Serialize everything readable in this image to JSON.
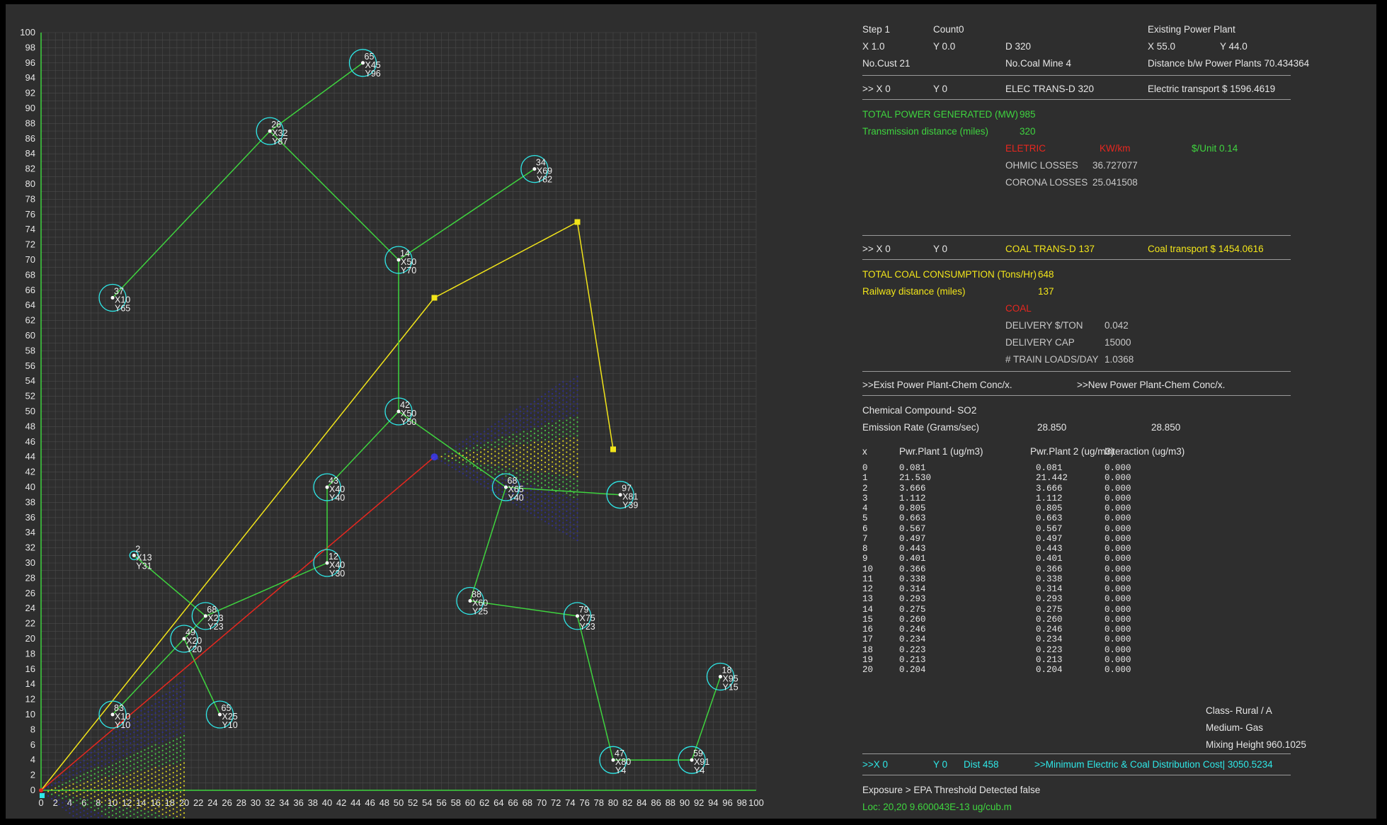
{
  "colors": {
    "background": "#2e2e2e",
    "grid": "#4a4a4a",
    "axis": "#3fd43f",
    "customer_ring": "#2ee8e8",
    "customer_link": "#3fd43f",
    "coal_route": "#f2e51a",
    "electric_route": "#e8271f",
    "plume_near": "#e8e020",
    "plume_mid": "#49d449",
    "plume_outer": "#2d2d9a"
  },
  "info": {
    "step": "Step 1",
    "count": "Count0",
    "existing_plant_title": "Existing Power Plant",
    "x": "X 1.0",
    "y": "Y 0.0",
    "d": "D 320",
    "existing_x": "X 55.0",
    "existing_y": "Y 44.0",
    "no_cust": "No.Cust 21",
    "no_coal_mine": "No.Coal Mine 4",
    "distance_plants": "Distance b/w Power Plants 70.434364"
  },
  "elec": {
    "x": ">> X 0",
    "y": "Y 0",
    "trans_d": "ELEC TRANS-D 320",
    "transport": "Electric transport $ 1596.4619",
    "total_power_label": "TOTAL POWER GENERATED (MW)",
    "total_power_value": "985",
    "trans_dist_label": "Transmission distance (miles)",
    "trans_dist_value": "320",
    "eletric": "ELETRIC",
    "kwkm": "KW/km",
    "unit": "$/Unit 0.14",
    "ohmic_label": "OHMIC LOSSES",
    "ohmic_value": "36.727077",
    "corona_label": "CORONA LOSSES",
    "corona_value": "25.041508"
  },
  "coal": {
    "x": ">> X 0",
    "y": "Y 0",
    "trans_d": "COAL TRANS-D 137",
    "transport": "Coal transport $ 1454.0616",
    "total_label": "TOTAL COAL CONSUMPTION (Tons/Hr)",
    "total_value": "648",
    "rail_label": "Railway distance (miles)",
    "rail_value": "137",
    "coal": "COAL",
    "delivery_ton_label": "DELIVERY $/TON",
    "delivery_ton_value": "0.042",
    "delivery_cap_label": "DELIVERY CAP",
    "delivery_cap_value": "15000",
    "train_loads_label": "# TRAIN LOADS/DAY",
    "train_loads_value": "1.0368"
  },
  "chem": {
    "exist_button": ">>Exist Power Plant-Chem Conc/x.",
    "new_button": ">>New Power Plant-Chem Conc/x.",
    "compound": "Chemical Compound- SO2",
    "emission_label": "Emission Rate (Grams/sec)",
    "emission_1": "28.850",
    "emission_2": "28.850",
    "headers": [
      "x",
      "Pwr.Plant 1 (ug/m3)",
      "Pwr.Plant 2 (ug/m3)",
      "Interaction (ug/m3)"
    ],
    "rows": [
      [
        "0",
        "0.081",
        "0.081",
        "0.000"
      ],
      [
        "1",
        "21.530",
        "21.442",
        "0.000"
      ],
      [
        "2",
        "3.666",
        "3.666",
        "0.000"
      ],
      [
        "3",
        "1.112",
        "1.112",
        "0.000"
      ],
      [
        "4",
        "0.805",
        "0.805",
        "0.000"
      ],
      [
        "5",
        "0.663",
        "0.663",
        "0.000"
      ],
      [
        "6",
        "0.567",
        "0.567",
        "0.000"
      ],
      [
        "7",
        "0.497",
        "0.497",
        "0.000"
      ],
      [
        "8",
        "0.443",
        "0.443",
        "0.000"
      ],
      [
        "9",
        "0.401",
        "0.401",
        "0.000"
      ],
      [
        "10",
        "0.366",
        "0.366",
        "0.000"
      ],
      [
        "11",
        "0.338",
        "0.338",
        "0.000"
      ],
      [
        "12",
        "0.314",
        "0.314",
        "0.000"
      ],
      [
        "13",
        "0.293",
        "0.293",
        "0.000"
      ],
      [
        "14",
        "0.275",
        "0.275",
        "0.000"
      ],
      [
        "15",
        "0.260",
        "0.260",
        "0.000"
      ],
      [
        "16",
        "0.246",
        "0.246",
        "0.000"
      ],
      [
        "17",
        "0.234",
        "0.234",
        "0.000"
      ],
      [
        "18",
        "0.223",
        "0.223",
        "0.000"
      ],
      [
        "19",
        "0.213",
        "0.213",
        "0.000"
      ],
      [
        "20",
        "0.204",
        "0.204",
        "0.000"
      ]
    ],
    "class": "Class-  Rural / A",
    "medium": "Medium-  Gas",
    "mixing_height": "Mixing Height  960.1025"
  },
  "footer": {
    "x": ">>X 0",
    "y": "Y 0",
    "dist": "Dist 458",
    "min_cost": ">>Minimum Electric & Coal Distribution Cost|  3050.5234",
    "exposure": "Exposure > EPA Threshold Detected  false",
    "loc": "Loc: 20,20  9.600043E-13 ug/cub.m"
  },
  "map": {
    "axis_max": 100,
    "x_ticks": [
      0,
      2,
      4,
      6,
      8,
      10,
      12,
      14,
      16,
      18,
      20,
      22,
      24,
      26,
      28,
      30,
      32,
      34,
      36,
      38,
      40,
      42,
      44,
      46,
      48,
      50,
      52,
      54,
      56,
      58,
      60,
      62,
      64,
      66,
      68,
      70,
      72,
      74,
      76,
      78,
      80,
      82,
      84,
      86,
      88,
      90,
      92,
      94,
      96,
      98,
      100
    ],
    "y_ticks": [
      0,
      2,
      4,
      6,
      8,
      10,
      12,
      14,
      16,
      18,
      20,
      22,
      24,
      26,
      28,
      30,
      32,
      34,
      36,
      38,
      40,
      42,
      44,
      46,
      48,
      50,
      52,
      54,
      56,
      58,
      60,
      62,
      64,
      66,
      68,
      70,
      72,
      74,
      76,
      78,
      80,
      82,
      84,
      86,
      88,
      90,
      92,
      94,
      96,
      98,
      100
    ],
    "customers": [
      {
        "id": "65",
        "x": 45,
        "y": 96,
        "xl": "X45",
        "yl": "Y96"
      },
      {
        "id": "26",
        "x": 32,
        "y": 87,
        "xl": "X32",
        "yl": "Y87"
      },
      {
        "id": "34",
        "x": 69,
        "y": 82,
        "xl": "X69",
        "yl": "Y82"
      },
      {
        "id": "37",
        "x": 10,
        "y": 65,
        "xl": "X10",
        "yl": "Y65"
      },
      {
        "id": "14",
        "x": 50,
        "y": 70,
        "xl": "X50",
        "yl": "Y70"
      },
      {
        "id": "42",
        "x": 50,
        "y": 50,
        "xl": "X50",
        "yl": "Y50"
      },
      {
        "id": "68",
        "x": 65,
        "y": 40,
        "xl": "X65",
        "yl": "Y40"
      },
      {
        "id": "97",
        "x": 81,
        "y": 39,
        "xl": "X81",
        "yl": "Y39"
      },
      {
        "id": "43",
        "x": 40,
        "y": 40,
        "xl": "X40",
        "yl": "Y40"
      },
      {
        "id": "12",
        "x": 40,
        "y": 30,
        "xl": "X40",
        "yl": "Y30"
      },
      {
        "id": "2",
        "x": 13,
        "y": 31,
        "xl": "X13",
        "yl": "Y31"
      },
      {
        "id": "68",
        "x": 23,
        "y": 23,
        "xl": "X23",
        "yl": "Y23"
      },
      {
        "id": "49",
        "x": 20,
        "y": 20,
        "xl": "X20",
        "yl": "Y20"
      },
      {
        "id": "65",
        "x": 25,
        "y": 10,
        "xl": "X25",
        "yl": "Y10"
      },
      {
        "id": "83",
        "x": 10,
        "y": 10,
        "xl": "X10",
        "yl": "Y10"
      },
      {
        "id": "88",
        "x": 60,
        "y": 25,
        "xl": "X60",
        "yl": "Y25"
      },
      {
        "id": "79",
        "x": 75,
        "y": 23,
        "xl": "X75",
        "yl": "Y23"
      },
      {
        "id": "47",
        "x": 80,
        "y": 4,
        "xl": "X80",
        "yl": "Y4"
      },
      {
        "id": "59",
        "x": 91,
        "y": 4,
        "xl": "X91",
        "yl": "Y4"
      },
      {
        "id": "18",
        "x": 95,
        "y": 15,
        "xl": "X95",
        "yl": "Y15"
      }
    ],
    "customer_links": [
      [
        0,
        1
      ],
      [
        1,
        3
      ],
      [
        1,
        4
      ],
      [
        4,
        2
      ],
      [
        4,
        5
      ],
      [
        5,
        6
      ],
      [
        6,
        7
      ],
      [
        5,
        8
      ],
      [
        8,
        9
      ],
      [
        9,
        11
      ],
      [
        10,
        11
      ],
      [
        11,
        12
      ],
      [
        12,
        13
      ],
      [
        12,
        14
      ],
      [
        6,
        15
      ],
      [
        15,
        16
      ],
      [
        16,
        17
      ],
      [
        17,
        18
      ],
      [
        18,
        19
      ]
    ],
    "coal_route": [
      [
        0,
        0
      ],
      [
        55,
        65
      ],
      [
        75,
        75
      ],
      [
        80,
        45
      ]
    ],
    "coal_mines": [
      [
        55,
        65
      ],
      [
        75,
        75
      ],
      [
        80,
        45
      ]
    ],
    "electric_route": [
      [
        0,
        0
      ],
      [
        55,
        44
      ]
    ],
    "existing_plant": [
      55,
      44
    ],
    "new_plant": [
      0,
      0
    ],
    "plumes": [
      {
        "source": [
          55,
          44
        ],
        "to_x": 75,
        "spread": 0.55
      },
      {
        "source": [
          0,
          0
        ],
        "to_x": 20,
        "spread": 0.75
      }
    ]
  }
}
